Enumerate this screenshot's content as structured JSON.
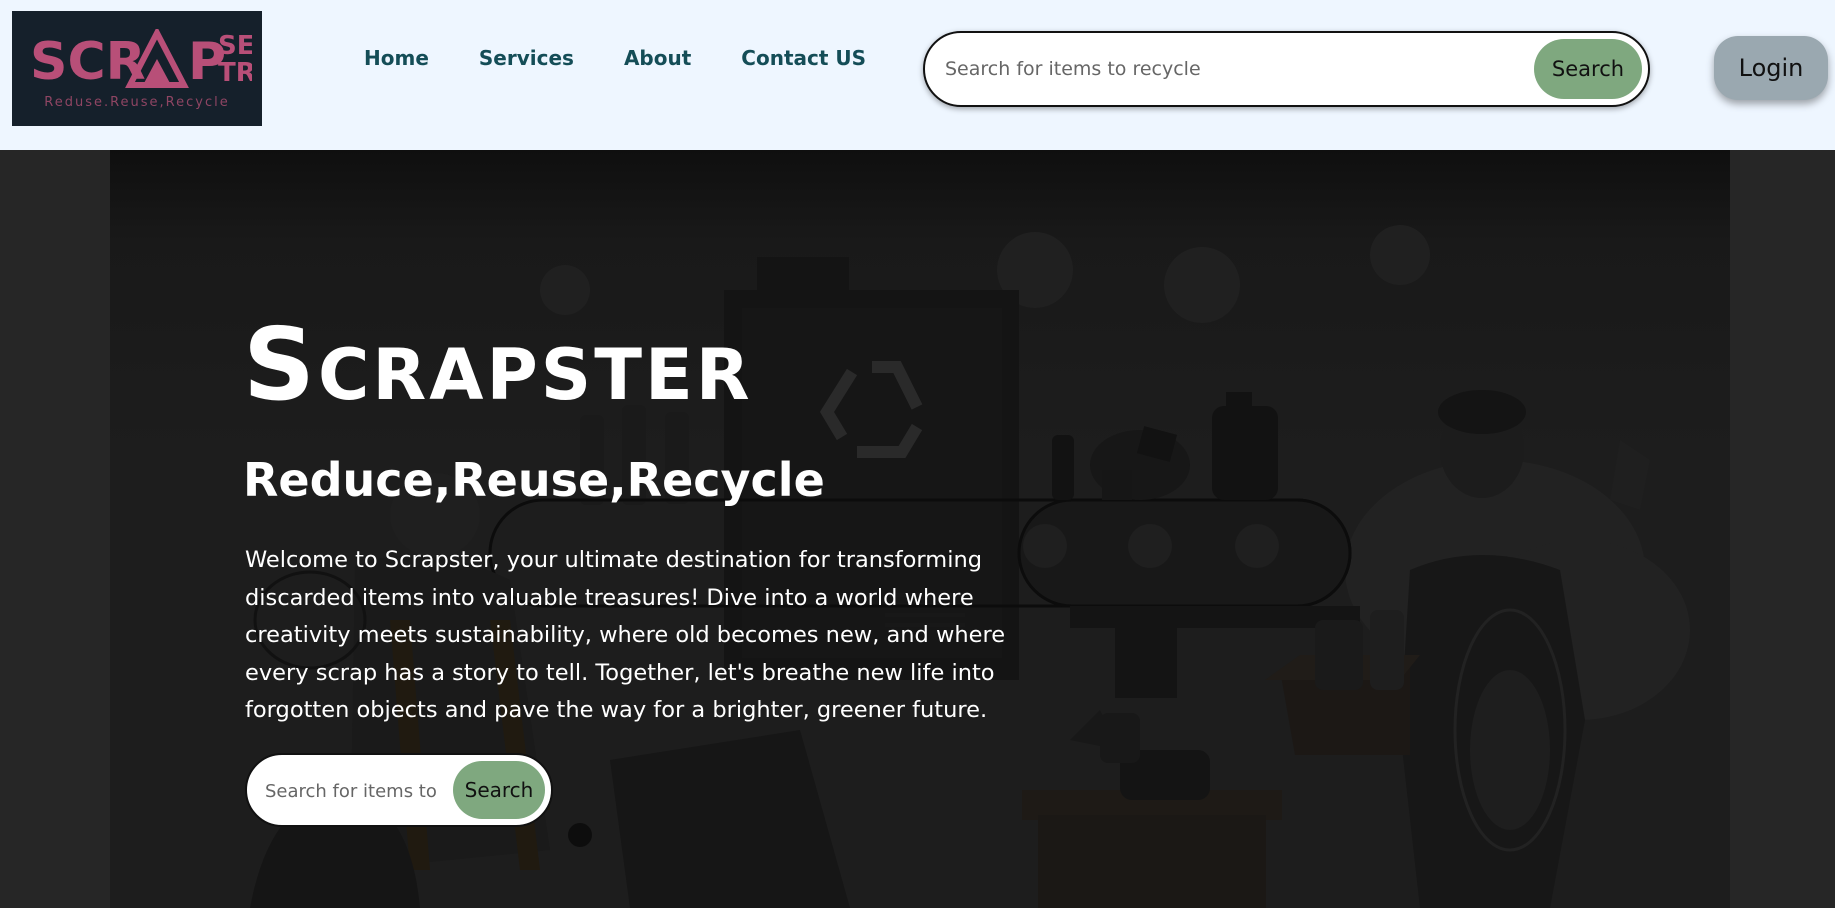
{
  "header": {
    "logo": {
      "wordmark": "SCRAPSTER",
      "tagline": "Reduse.Reuse,Recycle",
      "brand_color": "#b84f78",
      "background_color": "#15202b"
    },
    "nav": [
      {
        "label": "Home"
      },
      {
        "label": "Services"
      },
      {
        "label": "About"
      },
      {
        "label": "Contact US"
      }
    ],
    "search": {
      "placeholder": "Search for items to recycle",
      "button_label": "Search"
    },
    "login_label": "Login",
    "background_color": "#eef6ff"
  },
  "hero": {
    "title": "Scrapster",
    "subtitle": "Reduce,Reuse,Recycle",
    "description": "Welcome to Scrapster, your ultimate destination for transforming discarded items into valuable treasures! Dive into a world where creativity meets sustainability, where old becomes new, and where every scrap has a story to tell. Together, let's breathe new life into forgotten objects and pave the way for a brighter, greener future.",
    "search": {
      "placeholder": "Search for items to recycle",
      "button_label": "Search"
    },
    "background_illustration": "recycling-facility-illustration",
    "accent_color": "#7fa87f"
  }
}
